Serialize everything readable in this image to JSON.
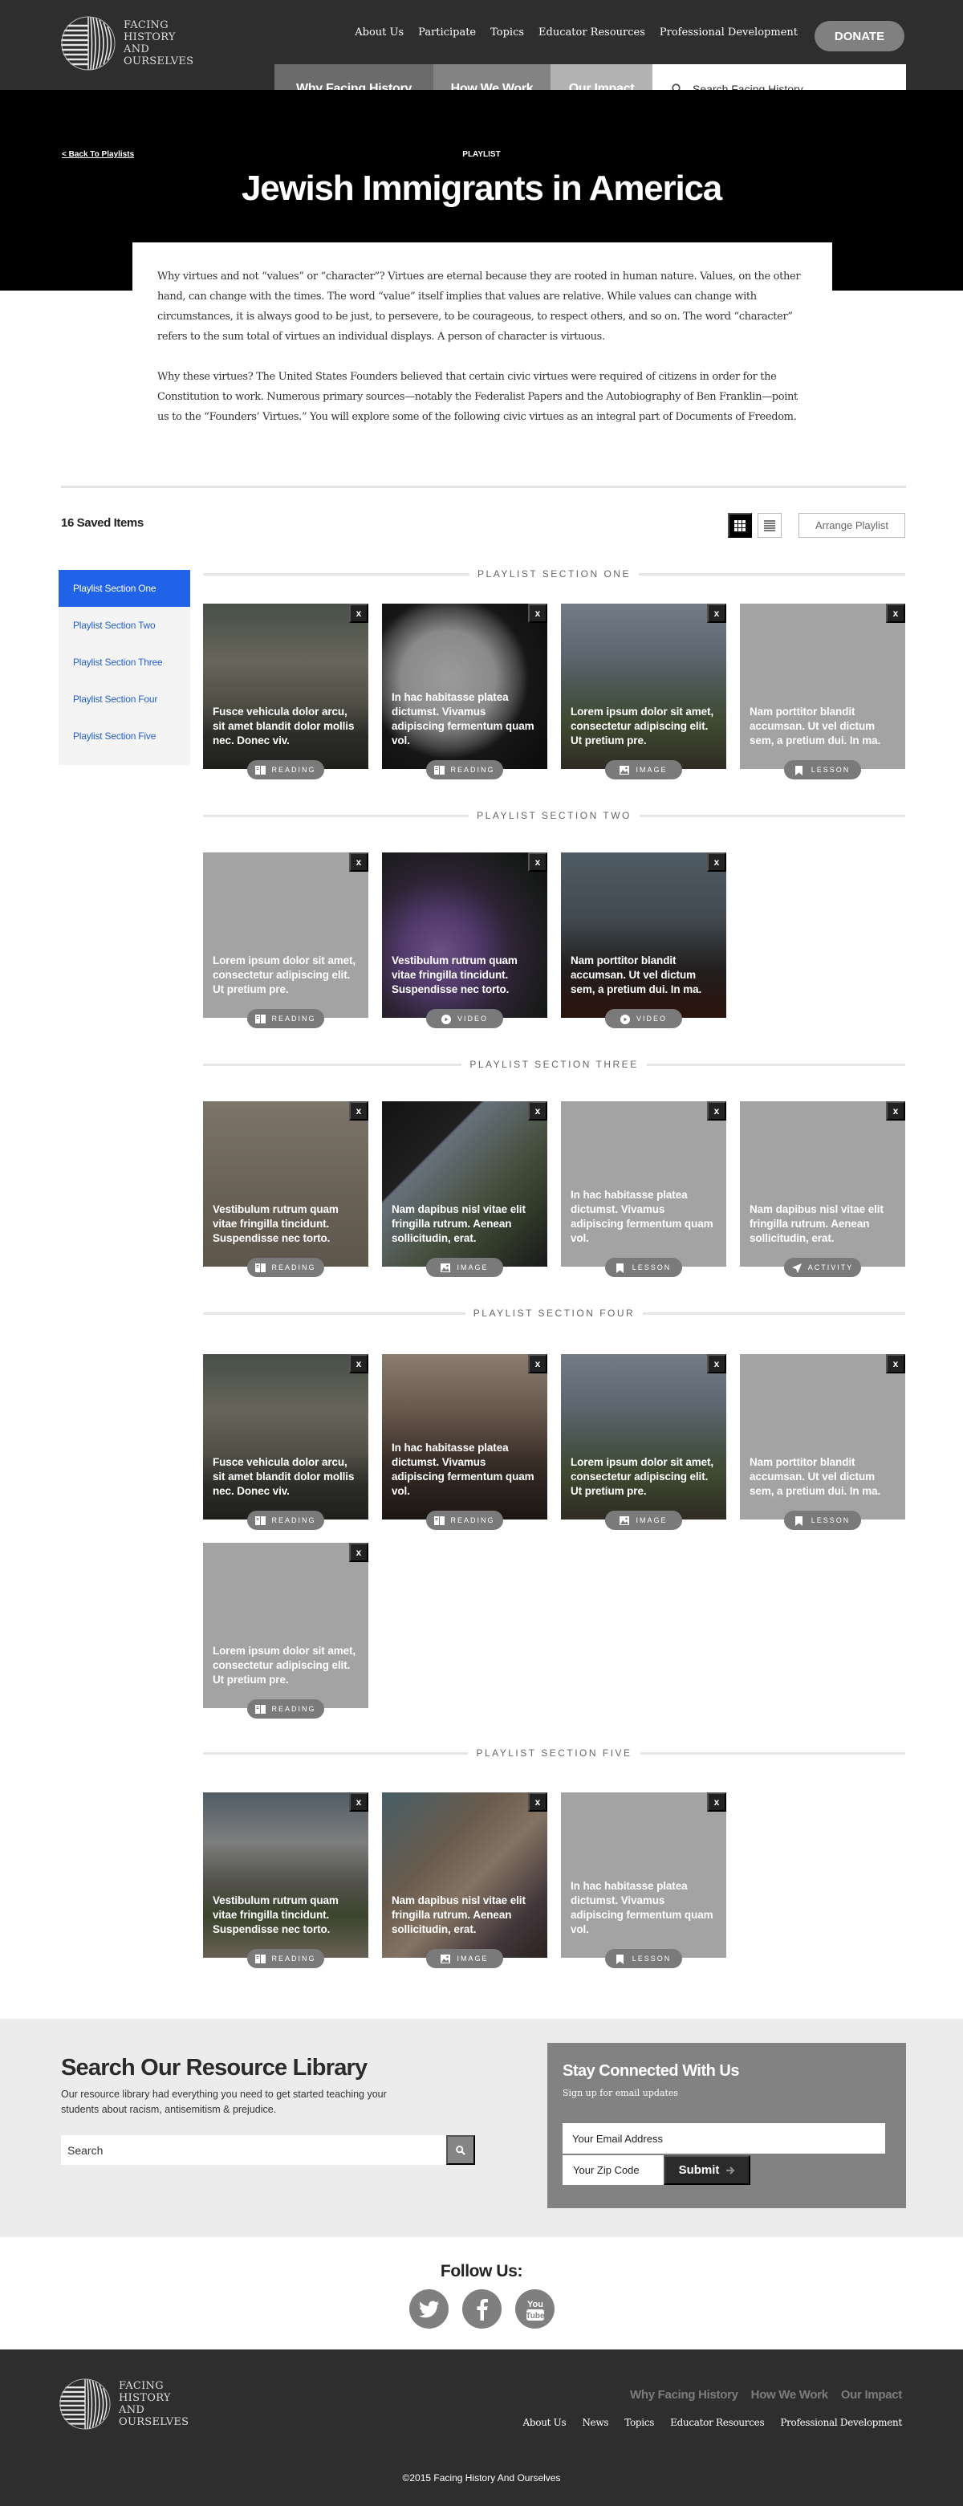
{
  "header": {
    "logo_lines": [
      "FACING",
      "HISTORY",
      "AND",
      "OURSELVES"
    ],
    "utility_nav": [
      "About Us",
      "Participate",
      "Topics",
      "Educator Resources",
      "Professional Development"
    ],
    "donate_label": "DONATE",
    "main_tabs": [
      "Why Facing History",
      "How We Work",
      "Our Impact"
    ],
    "search_placeholder": "Search Facing History"
  },
  "hero": {
    "back_link": "< Back To Playlists",
    "eyebrow": "PLAYLIST",
    "title": "Jewish Immigrants in America"
  },
  "intro": {
    "paragraphs": [
      "Why virtues and not “values” or “character”? Virtues are eternal because they are rooted in human nature. Values, on the other hand, can change with the times. The word “value” itself implies that values are relative. While values can change with circumstances, it is always good to be just, to persevere, to be courageous, to respect others, and so on. The word “character” refers to the sum total of virtues an individual displays. A person of character is virtuous.",
      "Why these virtues? The United States Founders believed that certain civic virtues were required of citizens in order for the Constitution to work. Numerous primary sources—notably the Federalist Papers and the Autobiography of Ben Franklin—point us to the “Founders’ Virtues.” You will explore some of the following civic virtues as an integral part of Documents of Freedom."
    ]
  },
  "toolbar": {
    "saved_count": "16 Saved Items",
    "grid_view": "grid-icon",
    "list_view": "list-icon",
    "arrange_label": "Arrange Playlist"
  },
  "sidebar": {
    "items": [
      {
        "label": "Playlist Section One",
        "active": true
      },
      {
        "label": "Playlist Section Two",
        "active": false
      },
      {
        "label": "Playlist Section Three",
        "active": false
      },
      {
        "label": "Playlist Section Four",
        "active": false
      },
      {
        "label": "Playlist Section Five",
        "active": false
      }
    ]
  },
  "close_label": "x",
  "sections": [
    {
      "title": "PLAYLIST SECTION ONE",
      "cards": [
        {
          "title": "Fusce vehicula dolor arcu, sit amet blandit dolor mollis nec. Donec viv.",
          "type": "READING",
          "image": "foggy-forest-railroad"
        },
        {
          "title": "In hac habitasse platea dictumst. Vivamus adipiscing fermentum quam vol.",
          "type": "READING",
          "image": "clock-face"
        },
        {
          "title": "Lorem ipsum dolor sit amet, consectetur adipiscing elit. Ut pretium pre.",
          "type": "IMAGE",
          "image": "mountain-ridge"
        },
        {
          "title": "Nam porttitor blandit accumsan. Ut vel dictum sem, a pretium dui. In ma.",
          "type": "LESSON",
          "image": "none"
        }
      ]
    },
    {
      "title": "PLAYLIST SECTION TWO",
      "cards": [
        {
          "title": "Lorem ipsum dolor sit amet, consectetur adipiscing elit. Ut pretium pre.",
          "type": "READING",
          "image": "none"
        },
        {
          "title": "Vestibulum rutrum quam vitae fringilla tincidunt. Suspendisse nec torto.",
          "type": "VIDEO",
          "image": "purple-flowers"
        },
        {
          "title": "Nam porttitor blandit accumsan. Ut vel dictum sem, a pretium dui. In ma.",
          "type": "VIDEO",
          "image": "rainy-window"
        }
      ]
    },
    {
      "title": "PLAYLIST SECTION THREE",
      "cards": [
        {
          "title": "Vestibulum rutrum quam vitae fringilla tincidunt. Suspendisse nec torto.",
          "type": "READING",
          "image": "footprints-sand"
        },
        {
          "title": "Nam dapibus nisl vitae elit fringilla rutrum. Aenean sollicitudin, erat.",
          "type": "IMAGE",
          "image": "dock-lake"
        },
        {
          "title": "In hac habitasse platea dictumst. Vivamus adipiscing fermentum quam vol.",
          "type": "LESSON",
          "image": "none"
        },
        {
          "title": "Nam dapibus nisl vitae elit fringilla rutrum. Aenean sollicitudin, erat.",
          "type": "ACTIVITY",
          "image": "none"
        }
      ]
    },
    {
      "title": "PLAYLIST SECTION FOUR",
      "cards": [
        {
          "title": "Fusce vehicula dolor arcu, sit amet blandit dolor mollis nec. Donec viv.",
          "type": "READING",
          "image": "foggy-forest-railroad"
        },
        {
          "title": "In hac habitasse platea dictumst. Vivamus adipiscing fermentum quam vol.",
          "type": "READING",
          "image": "street-bicycles"
        },
        {
          "title": "Lorem ipsum dolor sit amet, consectetur adipiscing elit. Ut pretium pre.",
          "type": "IMAGE",
          "image": "mountain-ridge"
        },
        {
          "title": "Nam porttitor blandit accumsan. Ut vel dictum sem, a pretium dui. In ma.",
          "type": "LESSON",
          "image": "none"
        },
        {
          "title": "Lorem ipsum dolor sit amet, consectetur adipiscing elit. Ut pretium pre.",
          "type": "READING",
          "image": "none"
        }
      ]
    },
    {
      "title": "PLAYLIST SECTION FIVE",
      "cards": [
        {
          "title": "Vestibulum rutrum quam vitae fringilla tincidunt. Suspendisse nec torto.",
          "type": "READING",
          "image": "chateau"
        },
        {
          "title": "Nam dapibus nisl vitae elit fringilla rutrum. Aenean sollicitudin, erat.",
          "type": "IMAGE",
          "image": "coffee-macarons"
        },
        {
          "title": "In hac habitasse platea dictumst. Vivamus adipiscing fermentum quam vol.",
          "type": "LESSON",
          "image": "none"
        }
      ]
    }
  ],
  "library": {
    "title": "Search Our Resource Library",
    "description": "Our resource library had everything you need to get started teaching your students about racism, antisemitism & prejudice.",
    "search_placeholder": "Search"
  },
  "connect": {
    "title": "Stay Connected With Us",
    "subtitle": "Sign up for email updates",
    "email_placeholder": "Your Email Address",
    "zip_placeholder": "Your Zip Code",
    "submit_label": "Submit"
  },
  "follow": {
    "title": "Follow Us:",
    "networks": [
      "twitter",
      "facebook",
      "youtube"
    ]
  },
  "footer": {
    "primary_links": [
      "Why Facing History",
      "How We Work",
      "Our Impact"
    ],
    "secondary_links": [
      "About Us",
      "News",
      "Topics",
      "Educator Resources",
      "Professional Development"
    ],
    "copyright": "©2015 Facing History And Ourselves"
  },
  "colors": {
    "accent_blue": "#2163e8",
    "header_bg": "#2e2e2e",
    "card_placeholder": "#a3a3a3",
    "badge": "#7a7a7a"
  }
}
